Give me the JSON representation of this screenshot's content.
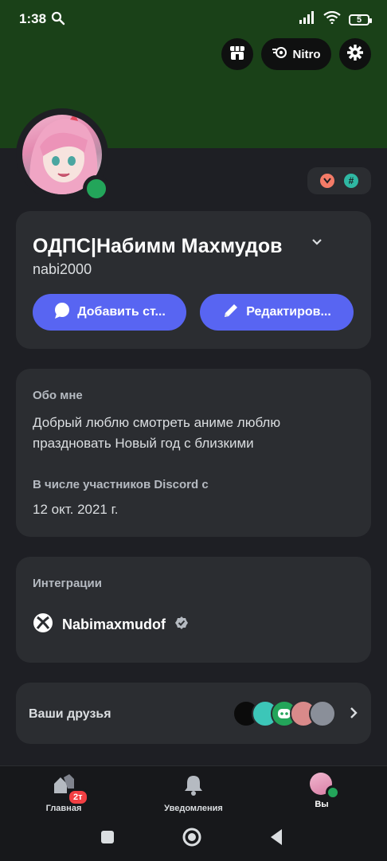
{
  "status_bar": {
    "time": "1:38",
    "battery": "5"
  },
  "header": {
    "nitro_label": "Nitro"
  },
  "colors": {
    "banner": "#1a4118",
    "accent": "#5865f2",
    "online": "#23a55a",
    "card": "#2b2d31",
    "background": "#1e1f24"
  },
  "profile": {
    "display_name": "ОДПС|Набимм Махмудов",
    "username": "nabi2000",
    "add_status_label": "Добавить ст...",
    "edit_profile_label": "Редактиров..."
  },
  "about": {
    "heading": "Обо мне",
    "text": "Добрый люблю смотреть аниме люблю праздновать Новый год с близкими",
    "member_since_heading": "В числе участников Discord с",
    "member_since_date": "12 окт. 2021 г."
  },
  "integrations": {
    "heading": "Интеграции",
    "xbox_name": "Nabimaxmudof"
  },
  "friends": {
    "label": "Ваши друзья"
  },
  "bottom_nav": {
    "home_label": "Главная",
    "home_badge": "2т",
    "notifications_label": "Уведомления",
    "you_label": "Вы"
  },
  "icons": [
    "search-icon",
    "signal-icon",
    "wifi-icon",
    "battery-icon",
    "shop-icon",
    "nitro-icon",
    "gear-icon",
    "chevron-down-icon",
    "speech-bubble-icon",
    "pencil-icon",
    "xbox-icon",
    "verified-icon",
    "chevron-right-icon",
    "home-icon",
    "bell-icon",
    "square-icon",
    "circle-icon",
    "back-icon"
  ]
}
